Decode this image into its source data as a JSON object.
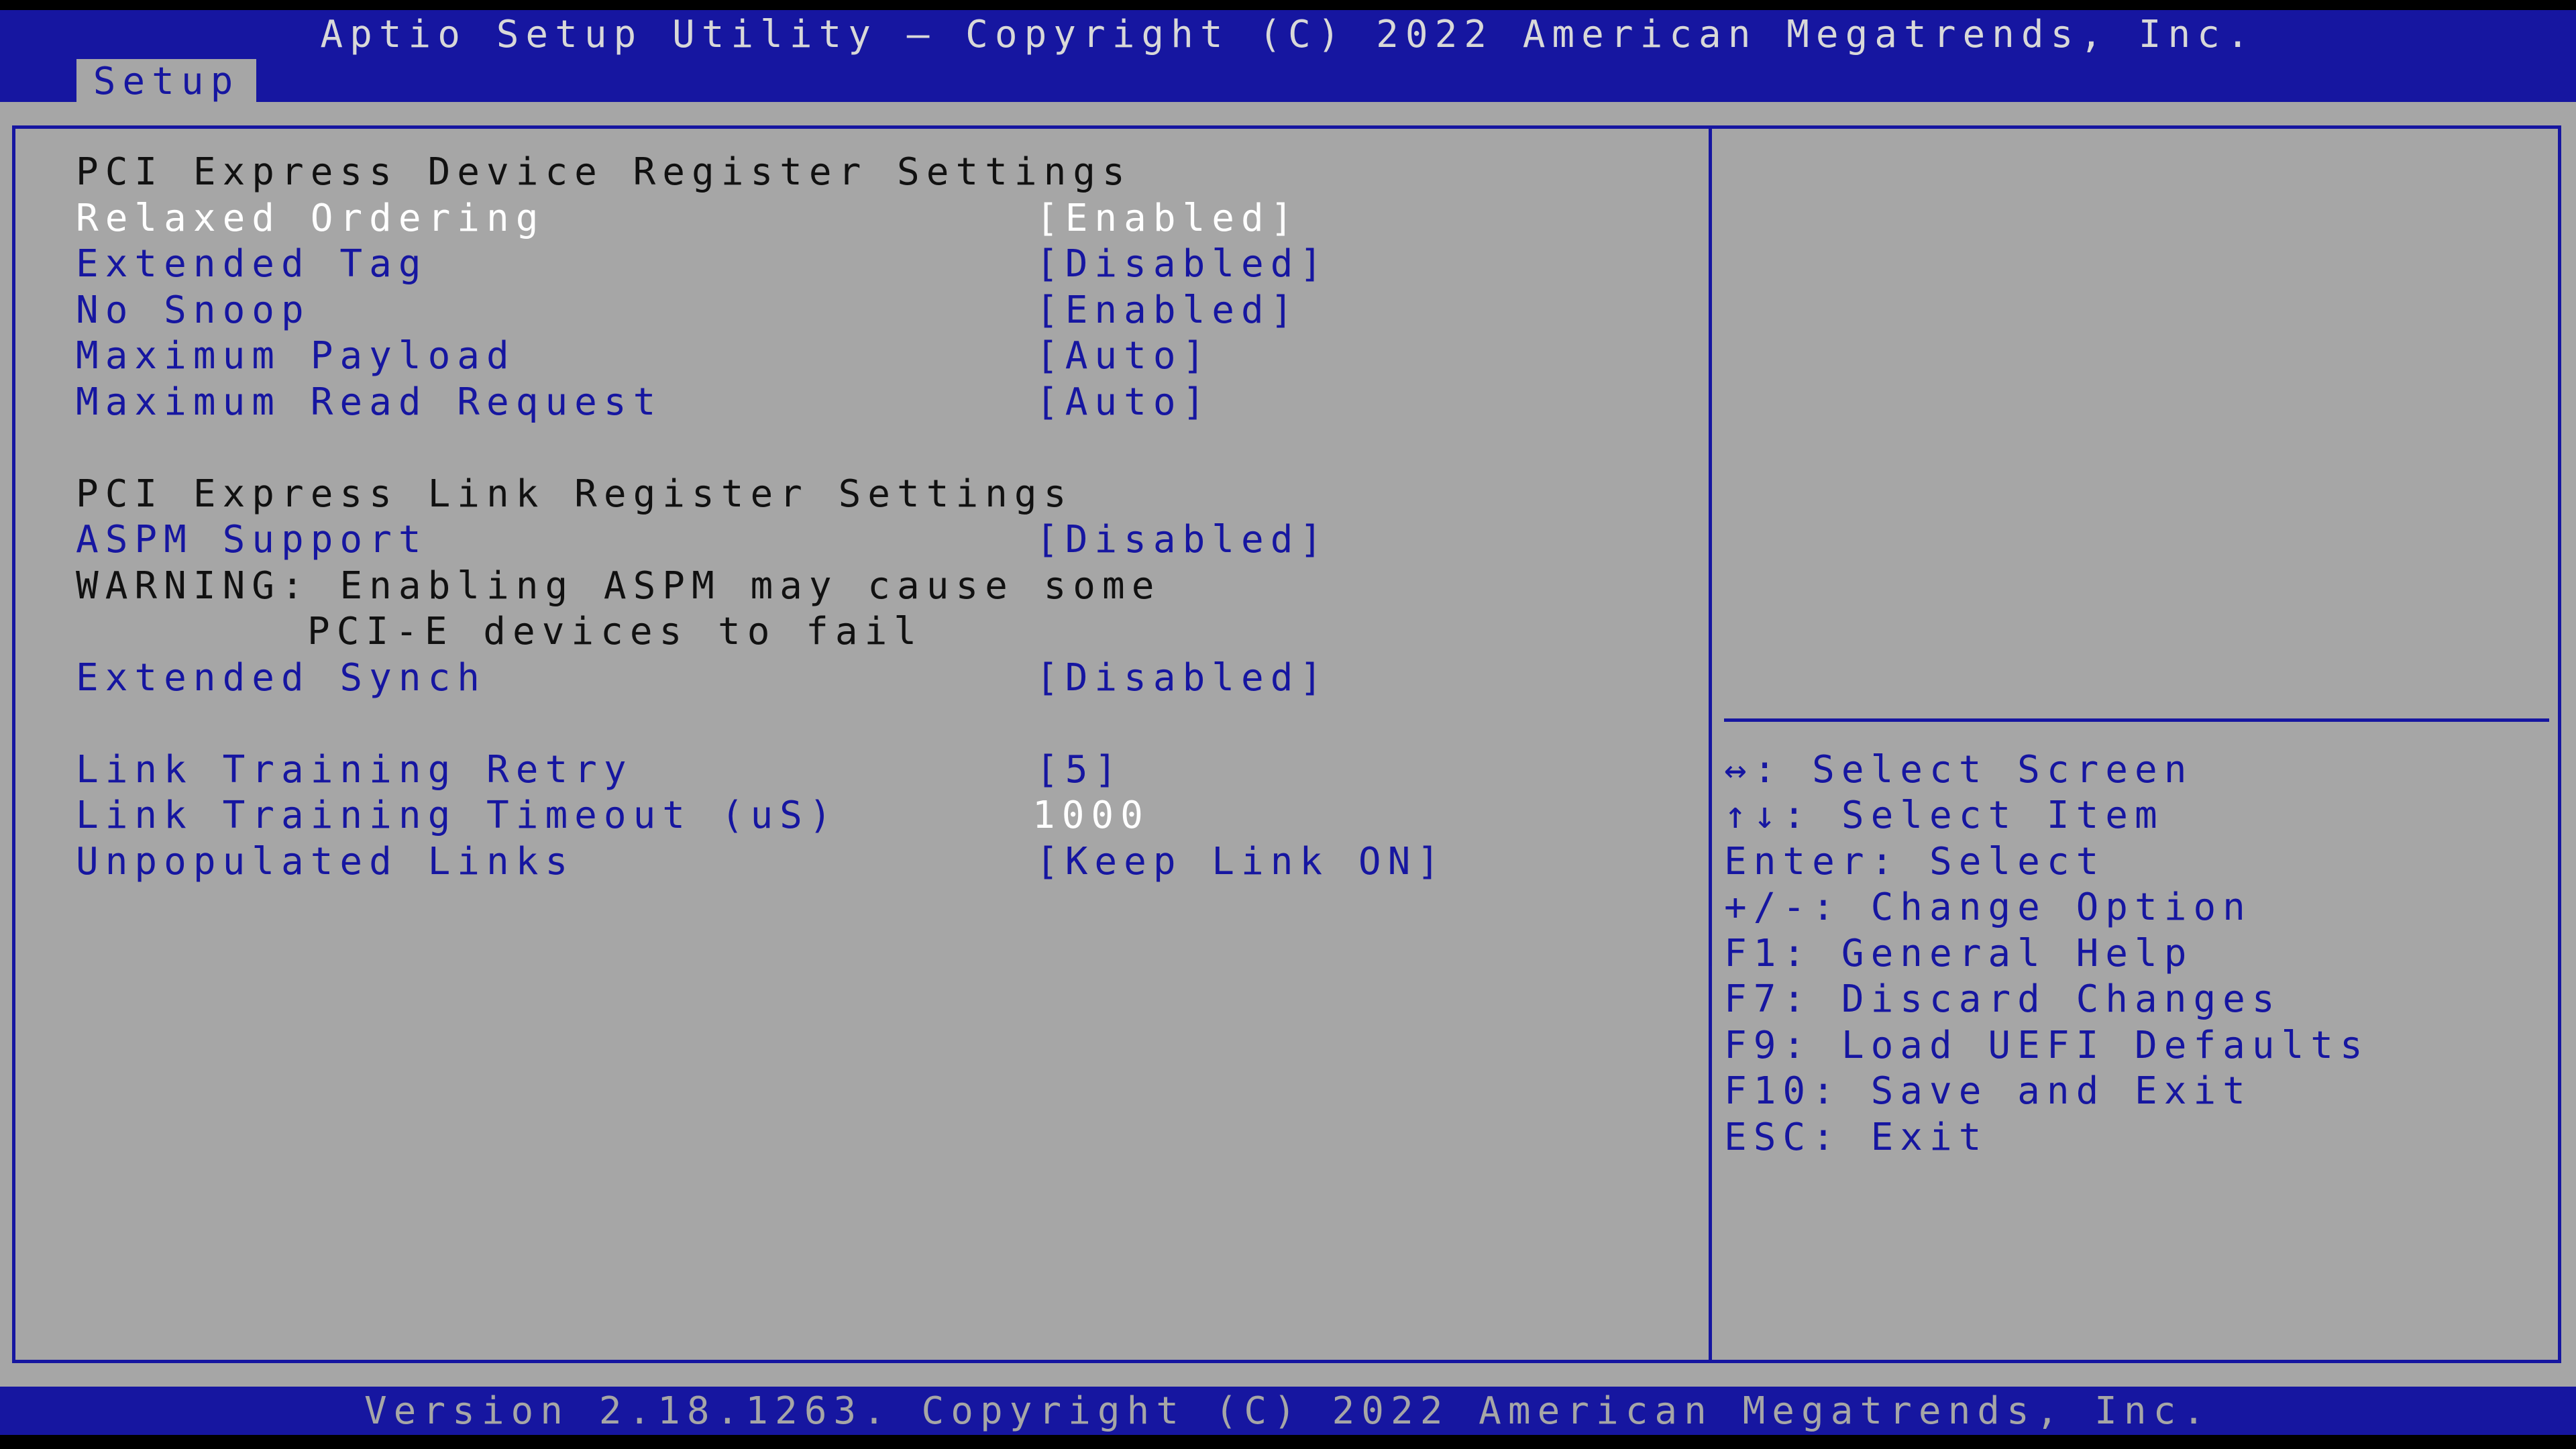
{
  "header": {
    "title": "Aptio Setup Utility – Copyright (C) 2022 American Megatrends, Inc.",
    "tabs": [
      {
        "label": "Setup"
      }
    ]
  },
  "sections": {
    "device_heading": "PCI Express Device Register Settings",
    "link_heading": "PCI Express Link Register Settings",
    "warning_line1": "WARNING: Enabling ASPM may cause some",
    "warning_line2": "PCI-E devices to fail"
  },
  "settings": [
    {
      "label": "Relaxed Ordering",
      "value": "[Enabled]"
    },
    {
      "label": "Extended Tag",
      "value": "[Disabled]"
    },
    {
      "label": "No Snoop",
      "value": "[Enabled]"
    },
    {
      "label": "Maximum Payload",
      "value": "[Auto]"
    },
    {
      "label": "Maximum Read Request",
      "value": "[Auto]"
    },
    {
      "label": "ASPM Support",
      "value": "[Disabled]"
    },
    {
      "label": "Extended Synch",
      "value": "[Disabled]"
    },
    {
      "label": "Link Training Retry",
      "value": "[5]"
    },
    {
      "label": "Link Training Timeout (uS)",
      "value": "1000"
    },
    {
      "label": "Unpopulated Links",
      "value": "[Keep Link ON]"
    }
  ],
  "selected_setting": "Relaxed Ordering",
  "help": {
    "keys": [
      {
        "key": "↔",
        "text": ": Select Screen"
      },
      {
        "key": "↑↓",
        "text": ": Select Item"
      },
      {
        "key": "",
        "text": "Enter: Select"
      },
      {
        "key": "",
        "text": "+/-: Change Option"
      },
      {
        "key": "",
        "text": "F1: General Help"
      },
      {
        "key": "",
        "text": "F7: Discard Changes"
      },
      {
        "key": "",
        "text": "F9: Load UEFI Defaults"
      },
      {
        "key": "",
        "text": "F10: Save and Exit"
      },
      {
        "key": "",
        "text": "ESC: Exit"
      }
    ]
  },
  "footer": {
    "version": "Version 2.18.1263. Copyright (C) 2022 American Megatrends, Inc."
  },
  "colors": {
    "bar_blue": "#1616a0",
    "panel_gray": "#a6a6a6",
    "selected_text": "#ffffff"
  }
}
